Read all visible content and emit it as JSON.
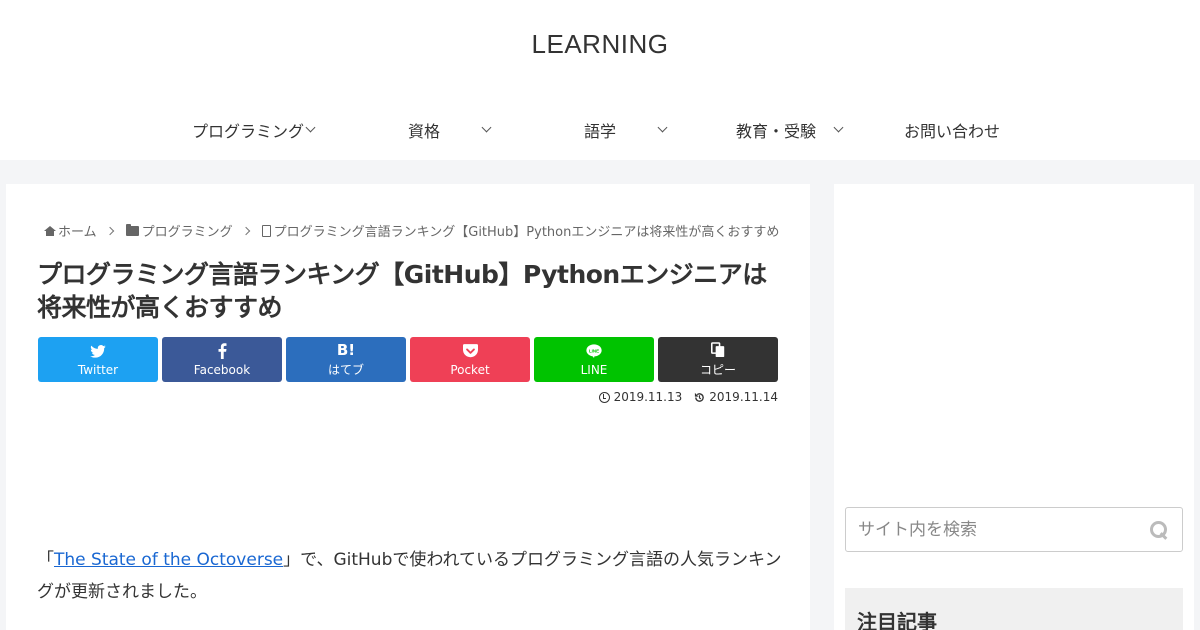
{
  "header": {
    "site_title": "LEARNING"
  },
  "nav": {
    "items": [
      {
        "label": "プログラミング",
        "has_submenu": true
      },
      {
        "label": "資格",
        "has_submenu": true
      },
      {
        "label": "語学",
        "has_submenu": true
      },
      {
        "label": "教育・受験",
        "has_submenu": true
      },
      {
        "label": "お問い合わせ",
        "has_submenu": false
      }
    ]
  },
  "breadcrumb": {
    "home": "ホーム",
    "category": "プログラミング",
    "current": "プログラミング言語ランキング【GitHub】Pythonエンジニアは将来性が高くおすすめ"
  },
  "article": {
    "title": "プログラミング言語ランキング【GitHub】Pythonエンジニアは将来性が高くおすすめ",
    "published": "2019.11.13",
    "updated": "2019.11.14",
    "intro_open": "「",
    "intro_link": "The State of the Octoverse",
    "intro_rest": "」で、GitHubで使われているプログラミング言語の人気ランキングが更新されました。"
  },
  "share": {
    "twitter": "Twitter",
    "facebook": "Facebook",
    "hatena": "はてブ",
    "hatena_icon": "B!",
    "pocket": "Pocket",
    "line": "LINE",
    "copy": "コピー"
  },
  "sidebar": {
    "search_placeholder": "サイト内を検索",
    "widget_title": "注目記事"
  },
  "colors": {
    "twitter": "#1da1f2",
    "facebook": "#3b5998",
    "hatena": "#2c6ebd",
    "pocket": "#ef4056",
    "line": "#00c300",
    "copy": "#333333",
    "link": "#1967d2"
  }
}
